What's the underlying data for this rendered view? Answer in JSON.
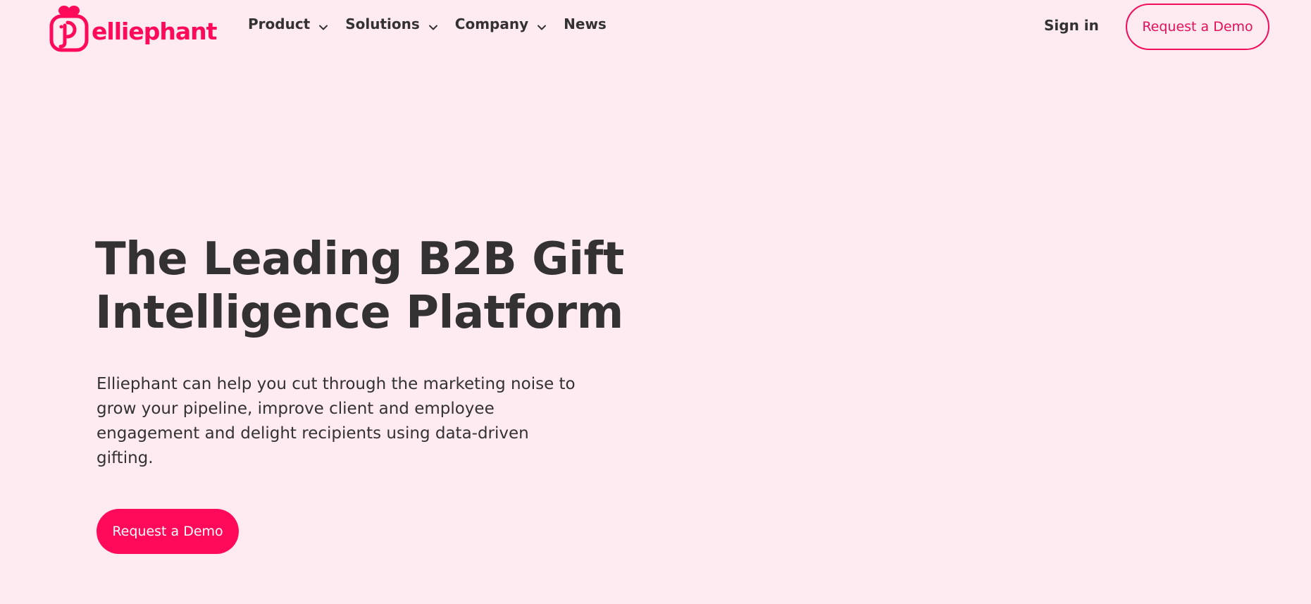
{
  "brand": {
    "name": "elliephant",
    "color": "#ff0a5a"
  },
  "nav": {
    "items": [
      {
        "label": "Product",
        "has_dropdown": true,
        "icon": "chevron-down-icon"
      },
      {
        "label": "Solutions",
        "has_dropdown": true,
        "icon": "chevron-down-icon"
      },
      {
        "label": "Company",
        "has_dropdown": true,
        "icon": "chevron-down-icon"
      },
      {
        "label": "News",
        "has_dropdown": false
      }
    ],
    "sign_in": "Sign in",
    "request_demo": "Request a Demo"
  },
  "hero": {
    "title_line1": "The Leading B2B Gift",
    "title_line2": "Intelligence Platform",
    "description": "Elliephant can help you cut through the marketing noise to grow your pipeline, improve client and employee engagement and delight recipients using data-driven gifting.",
    "cta": "Request a Demo"
  },
  "colors": {
    "background": "#feebf1",
    "accent": "#ff0a5a",
    "text": "#333132"
  }
}
